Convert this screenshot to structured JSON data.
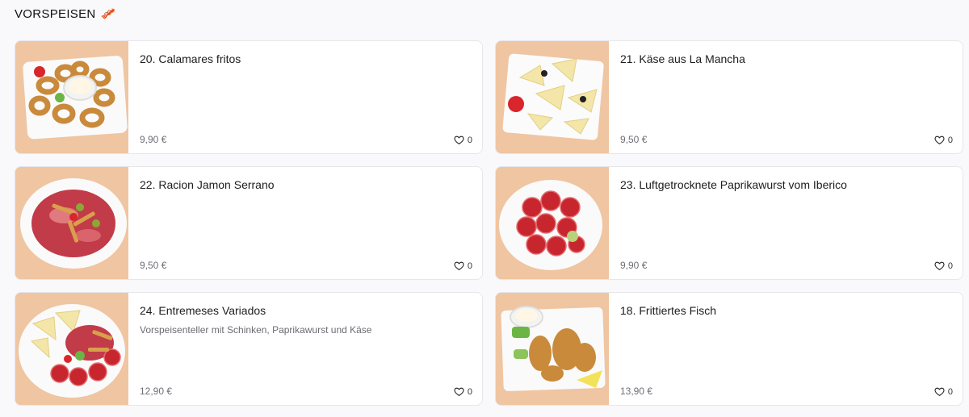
{
  "section": {
    "title": "VORSPEISEN",
    "emoji": "🥓"
  },
  "items": [
    {
      "name": "20. Calamares fritos",
      "description": "",
      "price": "9,90 €",
      "likes": "0",
      "dish": "calamari"
    },
    {
      "name": "21. Käse aus La Mancha",
      "description": "",
      "price": "9,50 €",
      "likes": "0",
      "dish": "cheese"
    },
    {
      "name": "22. Racion Jamon Serrano",
      "description": "",
      "price": "9,50 €",
      "likes": "0",
      "dish": "ham"
    },
    {
      "name": "23. Luftgetrocknete Paprikawurst vom Iberico",
      "description": "",
      "price": "9,90 €",
      "likes": "0",
      "dish": "chorizo"
    },
    {
      "name": "24. Entremeses Variados",
      "description": "Vorspeisenteller mit Schinken, Paprikawurst und Käse",
      "price": "12,90 €",
      "likes": "0",
      "dish": "mixed"
    },
    {
      "name": "18. Frittiertes Fisch",
      "description": "",
      "price": "13,90 €",
      "likes": "0",
      "dish": "fish"
    }
  ]
}
